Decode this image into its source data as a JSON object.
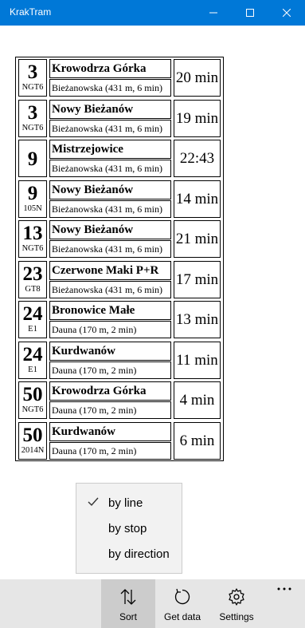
{
  "window": {
    "title": "KrakTram"
  },
  "departures": [
    {
      "line": "3",
      "vehicle": "NGT6",
      "destination": "Krowodrza Górka",
      "stop": "Bieżanowska (431 m, 6 min)",
      "time": "20 min"
    },
    {
      "line": "3",
      "vehicle": "NGT6",
      "destination": "Nowy Bieżanów",
      "stop": "Bieżanowska (431 m, 6 min)",
      "time": "19 min"
    },
    {
      "line": "9",
      "vehicle": "",
      "destination": "Mistrzejowice",
      "stop": "Bieżanowska (431 m, 6 min)",
      "time": "22:43"
    },
    {
      "line": "9",
      "vehicle": "105N",
      "destination": "Nowy Bieżanów",
      "stop": "Bieżanowska (431 m, 6 min)",
      "time": "14 min"
    },
    {
      "line": "13",
      "vehicle": "NGT6",
      "destination": "Nowy Bieżanów",
      "stop": "Bieżanowska (431 m, 6 min)",
      "time": "21 min"
    },
    {
      "line": "23",
      "vehicle": "GT8",
      "destination": "Czerwone Maki P+R",
      "stop": "Bieżanowska (431 m, 6 min)",
      "time": "17 min"
    },
    {
      "line": "24",
      "vehicle": "E1",
      "destination": "Bronowice Małe",
      "stop": "Dauna (170 m, 2 min)",
      "time": "13 min"
    },
    {
      "line": "24",
      "vehicle": "E1",
      "destination": "Kurdwanów",
      "stop": "Dauna (170 m, 2 min)",
      "time": "11 min"
    },
    {
      "line": "50",
      "vehicle": "NGT6",
      "destination": "Krowodrza Górka",
      "stop": "Dauna (170 m, 2 min)",
      "time": "4 min"
    },
    {
      "line": "50",
      "vehicle": "2014N",
      "destination": "Kurdwanów",
      "stop": "Dauna (170 m, 2 min)",
      "time": "6 min"
    }
  ],
  "sort_menu": {
    "items": [
      {
        "label": "by line",
        "checked": true
      },
      {
        "label": "by stop",
        "checked": false
      },
      {
        "label": "by direction",
        "checked": false
      }
    ]
  },
  "command_bar": {
    "sort_label": "Sort",
    "getdata_label": "Get data",
    "settings_label": "Settings",
    "more_label": "..."
  },
  "colors": {
    "titlebar": "#0078d7",
    "command_bar": "#e6e6e6",
    "active_command": "#cccccc"
  }
}
